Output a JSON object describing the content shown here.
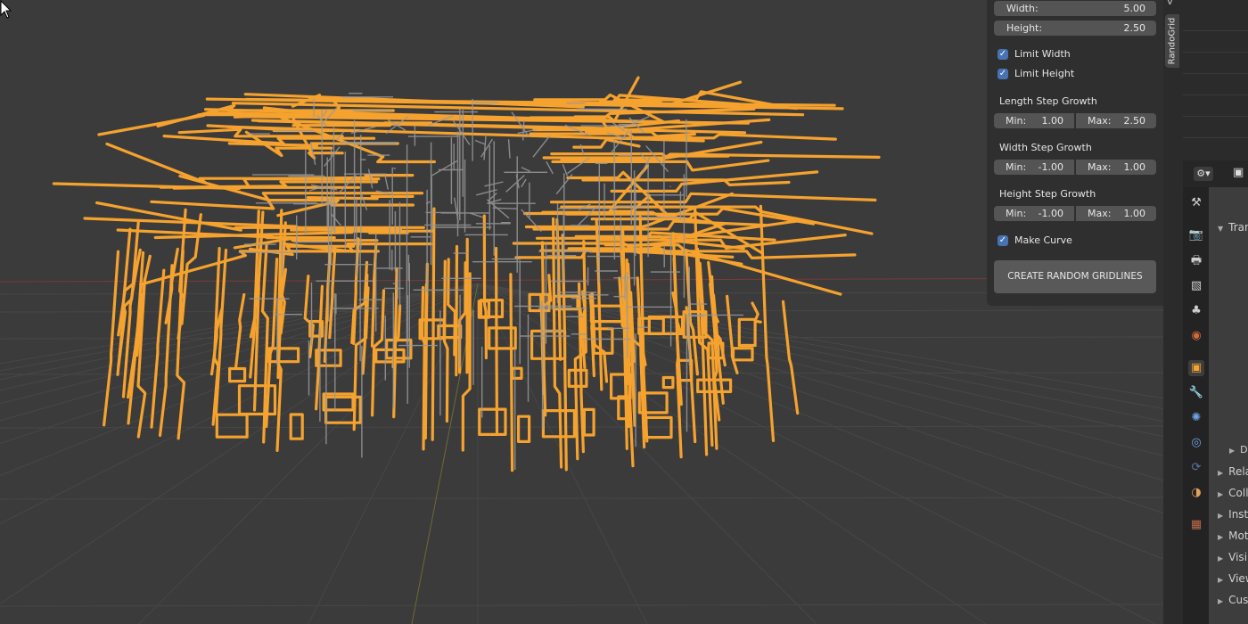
{
  "npanel": {
    "width": {
      "label": "Width:",
      "value": "5.00"
    },
    "height": {
      "label": "Height:",
      "value": "2.50"
    },
    "limit_width": {
      "label": "Limit Width",
      "checked": true
    },
    "limit_height": {
      "label": "Limit Height",
      "checked": true
    },
    "length_step": {
      "title": "Length Step Growth",
      "min_label": "Min:",
      "min": "1.00",
      "max_label": "Max:",
      "max": "2.50"
    },
    "width_step": {
      "title": "Width Step Growth",
      "min_label": "Min:",
      "min": "-1.00",
      "max_label": "Max:",
      "max": "1.00"
    },
    "height_step": {
      "title": "Height Step Growth",
      "min_label": "Min:",
      "min": "-1.00",
      "max_label": "Max:",
      "max": "1.00"
    },
    "make_curve": {
      "label": "Make Curve",
      "checked": true
    },
    "create_button": "CREATE RANDOM GRIDLINES"
  },
  "sidebar_tabs": {
    "active": "RandoGrid",
    "top_partial": "V"
  },
  "properties": {
    "sections": [
      "Tran",
      "D",
      "Rela",
      "Coll",
      "Insta",
      "Moti",
      "Visi",
      "View",
      "Cust"
    ]
  },
  "colors": {
    "selection": "#f5a22e",
    "wire": "#9a9a9a",
    "checkbox": "#4772b3",
    "viewport": "#3b3b3b"
  }
}
